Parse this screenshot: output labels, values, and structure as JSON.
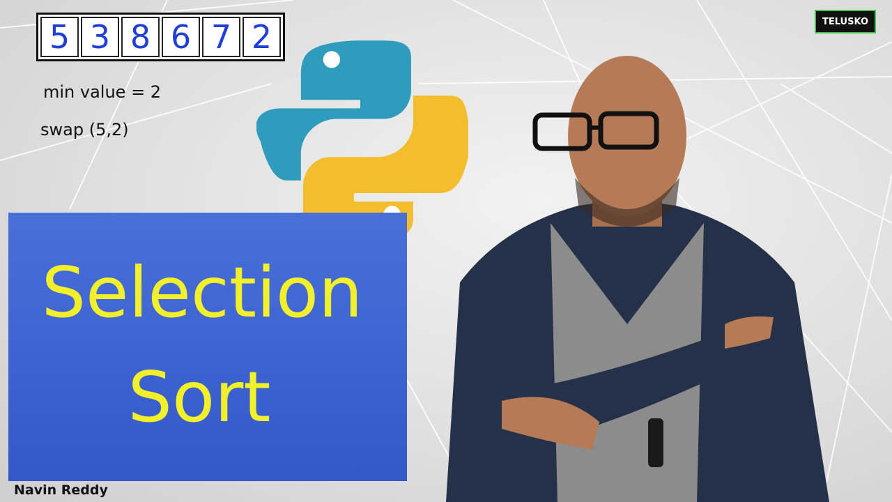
{
  "array": {
    "values": [
      "5",
      "3",
      "8",
      "6",
      "7",
      "2"
    ]
  },
  "notes": {
    "min_value": "min value = 2",
    "swap": "swap (5,2)"
  },
  "title": {
    "line1": "Selection",
    "line2": "Sort"
  },
  "author": "Navin Reddy",
  "brand": "TELUSKO",
  "colors": {
    "cell_text": "#1f3fd6",
    "title_box": "#3f63d1",
    "title_text": "#f2f02a",
    "python_blue": "#2f9bbd",
    "python_yellow": "#f3bd2b",
    "brand_border": "#43c44a"
  },
  "icons": [
    "python-logo-icon",
    "presenter-illustration"
  ]
}
